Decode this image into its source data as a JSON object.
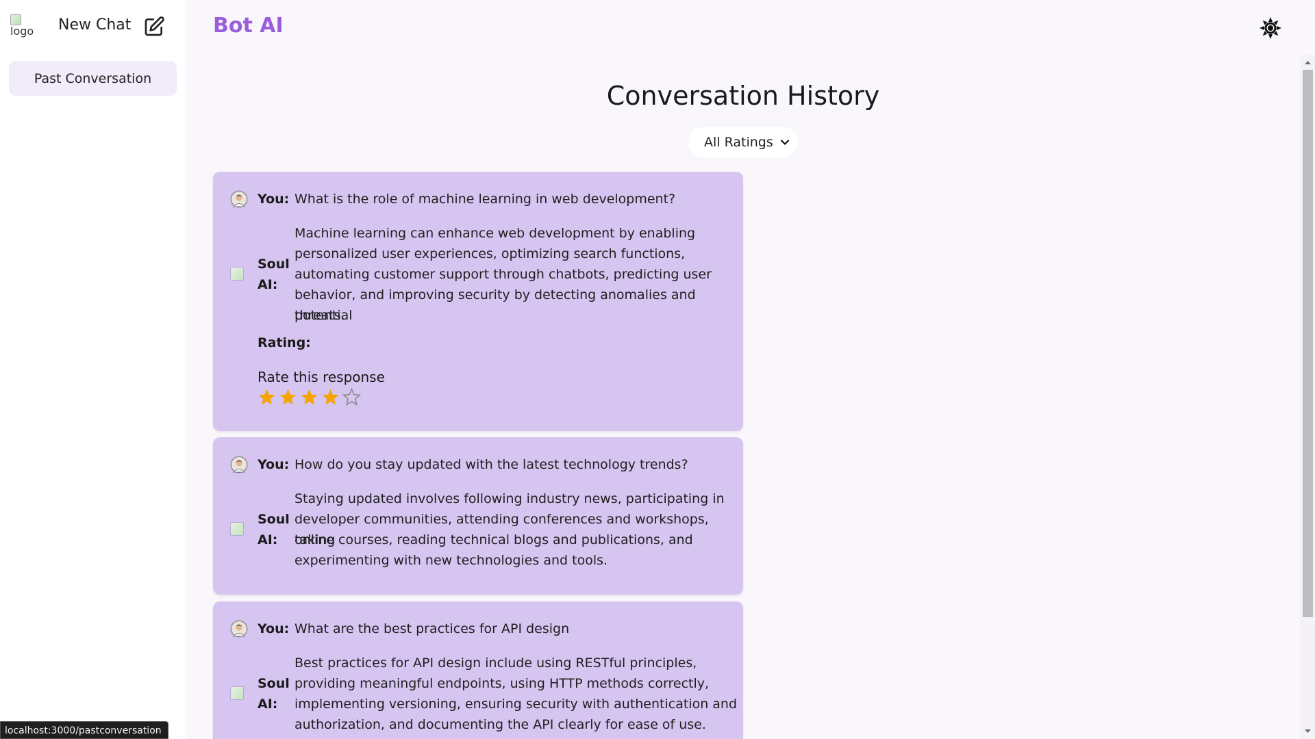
{
  "sidebar": {
    "logo_alt": "logo",
    "new_chat_label": "New Chat",
    "past_conversation_label": "Past Conversation"
  },
  "header": {
    "brand": "Bot AI"
  },
  "main": {
    "title": "Conversation History",
    "filter": {
      "selected": "All Ratings"
    }
  },
  "conversations": [
    {
      "user_label": "You:",
      "question": "What is the role of machine learning in web development?",
      "bot_label_line1": "Soul",
      "bot_label_line2": "AI:",
      "answer_lines": [
        "Machine learning can enhance web development by enabling",
        "personalized user experiences, optimizing search functions,",
        "automating customer support through chatbots, predicting user",
        "behavior, and improving security by detecting anomalies and potential",
        "threats."
      ],
      "rating_label": "Rating:",
      "rate_prompt": "Rate this response",
      "rating_value": 4,
      "rating_max": 5
    },
    {
      "user_label": "You:",
      "question": "How do you stay updated with the latest technology trends?",
      "bot_label_line1": "Soul",
      "bot_label_line2": "AI:",
      "answer_lines": [
        "Staying updated involves following industry news, participating in",
        "developer communities, attending conferences and workshops, taking",
        "online courses, reading technical blogs and publications, and",
        "experimenting with new technologies and tools."
      ]
    },
    {
      "user_label": "You:",
      "question": "What are the best practices for API design",
      "bot_label_line1": "Soul",
      "bot_label_line2": "AI:",
      "answer_lines": [
        "Best practices for API design include using RESTful principles,",
        "providing meaningful endpoints, using HTTP methods correctly,",
        "implementing versioning, ensuring security with authentication and",
        "authorization, and documenting the API clearly for ease of use."
      ]
    }
  ],
  "status_bar": {
    "hover_url": "localhost:3000/pastconversation"
  },
  "colors": {
    "brand": "#9a5ddc",
    "card": "#d6c5f1",
    "star_filled": "#f5a400",
    "star_empty": "#8a8a8a"
  },
  "icons": {
    "edit": "edit-icon",
    "theme": "sun-icon",
    "user_avatar": "user-avatar-icon",
    "bot_avatar": "bot-avatar-icon"
  }
}
